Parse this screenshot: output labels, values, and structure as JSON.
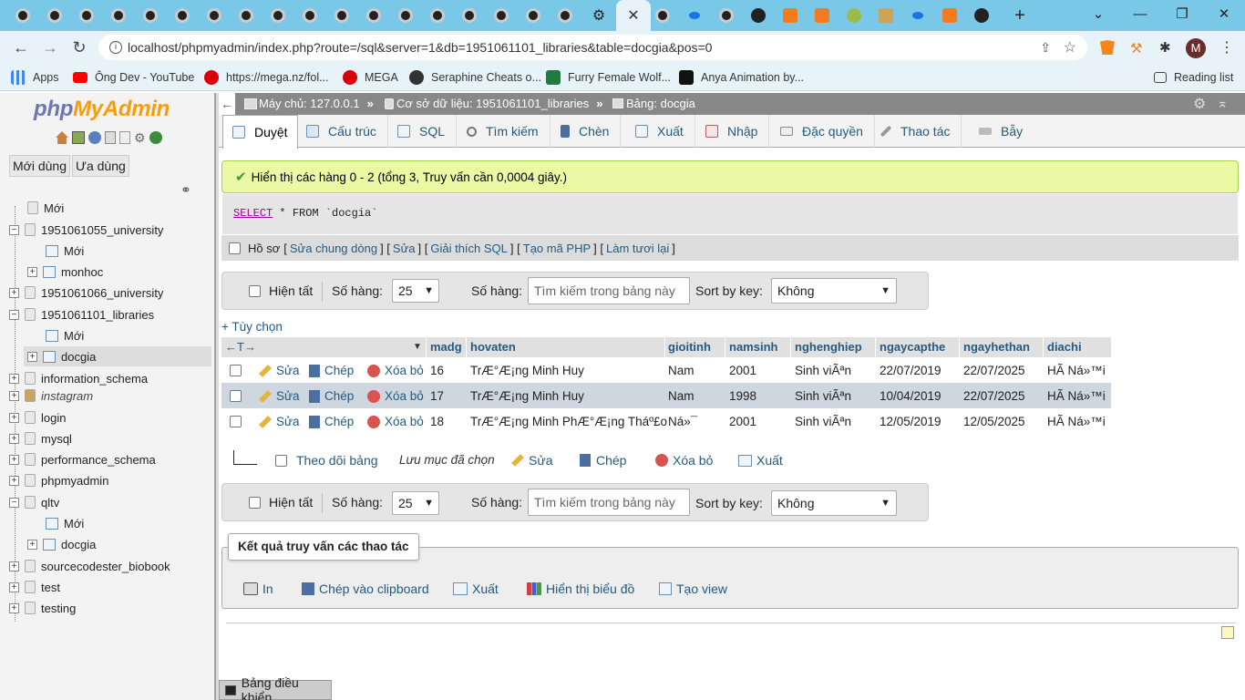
{
  "browser": {
    "url": "localhost/phpmyadmin/index.php?route=/sql&server=1&db=1951061101_libraries&table=docgia&pos=0",
    "new_tab_label": "+",
    "bookmarks": [
      {
        "label": "Apps",
        "icon": "apps-grid-icon",
        "color": "#4285f4"
      },
      {
        "label": "Ông Dev - YouTube",
        "icon": "youtube-icon",
        "color": "#ff0000"
      },
      {
        "label": "https://mega.nz/fol...",
        "icon": "mega-icon",
        "color": "#d90007"
      },
      {
        "label": "MEGA",
        "icon": "mega-icon",
        "color": "#d90007"
      },
      {
        "label": "Seraphine Cheats o...",
        "icon": "globe-icon",
        "color": "#333333"
      },
      {
        "label": "Furry Female Wolf...",
        "icon": "wolf-icon",
        "color": "#1e7c40"
      },
      {
        "label": "Anya Animation by...",
        "icon": "anya-icon",
        "color": "#111111"
      }
    ],
    "reading_list": "Reading list",
    "profile_initial": "M"
  },
  "sidebar": {
    "logo_php": "php",
    "logo_myadmin": "MyAdmin",
    "recent_tab": "Mới dùng",
    "favorites_tab": "Ưa dùng",
    "tree": {
      "new": "Mới",
      "db1": "1951061055_university",
      "db1_new": "Mới",
      "db1_table": "monhoc",
      "db2": "1951061066_university",
      "db3": "1951061101_libraries",
      "db3_new": "Mới",
      "db3_table": "docgia",
      "db4": "information_schema",
      "db5": "instagram",
      "db6": "login",
      "db7": "mysql",
      "db8": "performance_schema",
      "db9": "phpmyadmin",
      "db10": "qltv",
      "db10_new": "Mới",
      "db10_table": "docgia",
      "db11": "sourcecodester_biobook",
      "db12": "test",
      "db13": "testing"
    }
  },
  "breadcrumb": {
    "server": "Máy chủ: 127.0.0.1",
    "database": "Cơ sở dữ liệu: 1951061101_libraries",
    "table": "Bảng: docgia",
    "sep": "»"
  },
  "tabs": [
    "Duyệt",
    "Cấu trúc",
    "SQL",
    "Tìm kiếm",
    "Chèn",
    "Xuất",
    "Nhập",
    "Đặc quyền",
    "Thao tác",
    "Bẫy"
  ],
  "message": {
    "success": "Hiển thị các hàng 0 - 2 (tổng 3, Truy vấn cần 0,0004 giây.)",
    "sql_keyword": "SELECT",
    "sql_rest": " * FROM `docgia`"
  },
  "sql_links": {
    "profile": "Hồ sơ",
    "inline_edit": "Sửa chung dòng",
    "edit": "Sửa",
    "explain": "Giải thích SQL",
    "create_php": "Tạo mã PHP",
    "refresh": "Làm tươi lại"
  },
  "nav": {
    "show_all": "Hiện tất",
    "rows_label": "Số hàng:",
    "rows_value": "25",
    "filter_label": "Số hàng:",
    "filter_placeholder": "Tìm kiếm trong bảng này",
    "sort_label": "Sort by key:",
    "sort_value": "Không"
  },
  "options_link": "+ Tùy chọn",
  "table": {
    "columns": [
      "madg",
      "hovaten",
      "gioitinh",
      "namsinh",
      "nghenghiep",
      "ngaycapthe",
      "ngayhethan",
      "diachi"
    ],
    "actions": {
      "edit": "Sửa",
      "copy": "Chép",
      "delete": "Xóa bỏ"
    },
    "rows": [
      [
        "16",
        "TrÆ°Æ¡ng Minh Huy",
        "Nam",
        "2001",
        "Sinh viÃªn",
        "22/07/2019",
        "22/07/2025",
        "HÃ  Ná»™i"
      ],
      [
        "17",
        "TrÆ°Æ¡ng Minh Huy",
        "Nam",
        "1998",
        "Sinh viÃªn",
        "10/04/2019",
        "22/07/2025",
        "HÃ  Ná»™i"
      ],
      [
        "18",
        "TrÆ°Æ¡ng Minh PhÆ°Æ¡ng Tháº£o",
        "Ná»¯",
        "2001",
        "Sinh viÃªn",
        "12/05/2019",
        "12/05/2025",
        "HÃ  Ná»™i"
      ]
    ]
  },
  "bulk": {
    "check_all": "Theo dõi bảng",
    "with_selected": "Lưu mục đã chọn",
    "edit": "Sửa",
    "copy": "Chép",
    "delete": "Xóa bỏ",
    "export": "Xuất"
  },
  "query_ops": {
    "title": "Kết quả truy vấn các thao tác",
    "print": "In",
    "clipboard": "Chép vào clipboard",
    "export": "Xuất",
    "chart": "Hiển thị biểu đồ",
    "create_view": "Tạo view"
  },
  "console": "Bảng điều khiển"
}
